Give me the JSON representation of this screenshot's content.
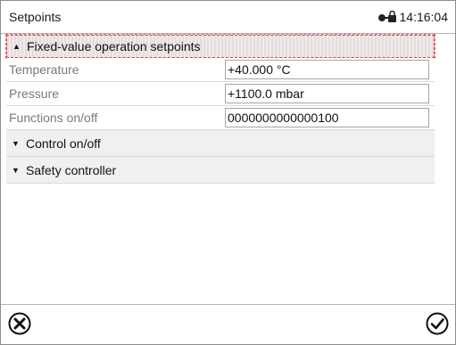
{
  "header": {
    "title": "Setpoints",
    "time": "14:16:04",
    "status_icon": "lock-key-icon"
  },
  "section_expanded": {
    "label": "Fixed-value operation setpoints",
    "expanded": true
  },
  "rows": [
    {
      "label": "Temperature",
      "value": "+40.000 °C"
    },
    {
      "label": "Pressure",
      "value": "+1100.0 mbar"
    },
    {
      "label": "Functions on/off",
      "value": "0000000000000100"
    }
  ],
  "sections_collapsed": [
    {
      "label": "Control on/off"
    },
    {
      "label": "Safety controller"
    }
  ],
  "footer": {
    "cancel_icon": "cancel-circle-icon",
    "confirm_icon": "confirm-check-circle-icon"
  },
  "colors": {
    "focus_border": "#d8414b",
    "section_bg": "#f0f0f0",
    "label_gray": "#7a7a7a"
  }
}
